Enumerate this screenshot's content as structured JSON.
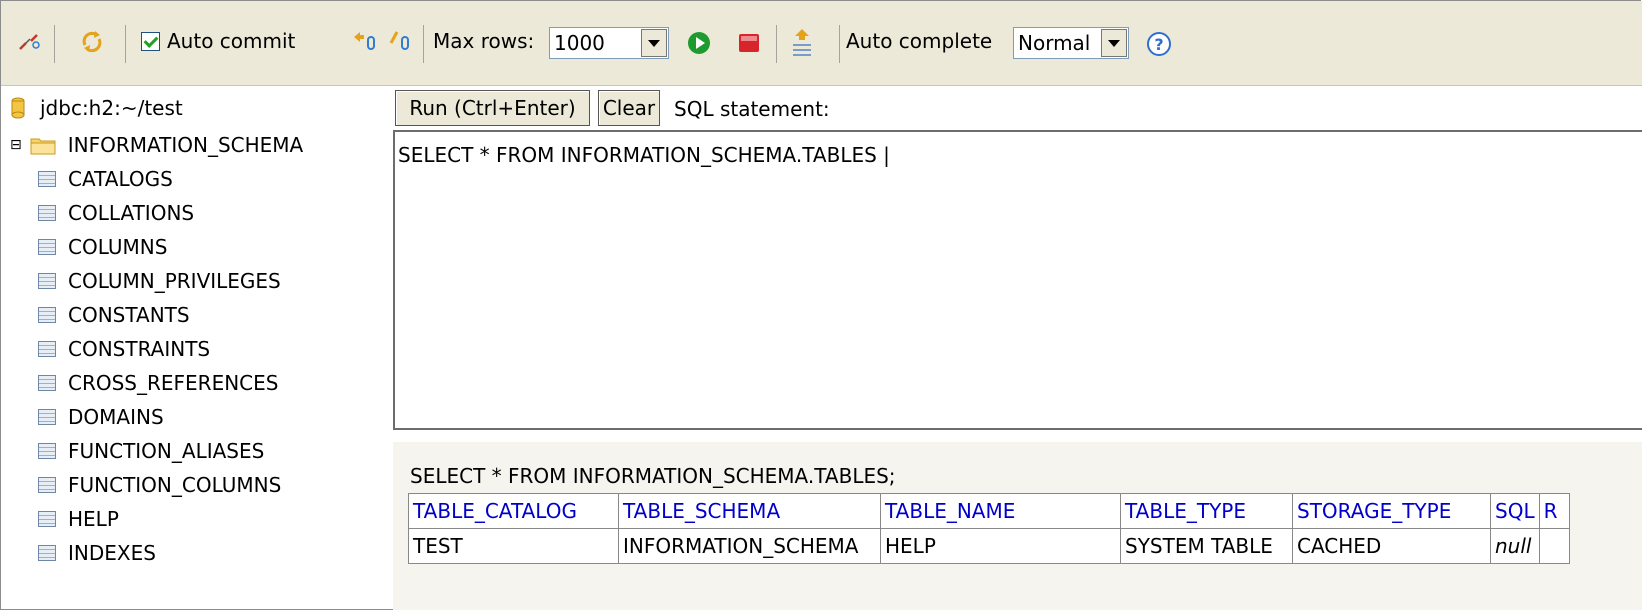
{
  "toolbar": {
    "auto_commit_label": "Auto commit",
    "auto_commit_checked": true,
    "max_rows_label": "Max rows:",
    "max_rows_value": "1000",
    "auto_complete_label": "Auto complete",
    "auto_complete_value": "Normal",
    "icons": [
      "disconnect-icon",
      "refresh-icon",
      "autocommit-on-icon",
      "autocommit-off-icon",
      "run-icon",
      "stop-icon",
      "history-icon",
      "help-icon"
    ]
  },
  "tree": {
    "connection": "jdbc:h2:~/test",
    "schema": "INFORMATION_SCHEMA",
    "expand_glyph": "⊟",
    "tables": [
      "CATALOGS",
      "COLLATIONS",
      "COLUMNS",
      "COLUMN_PRIVILEGES",
      "CONSTANTS",
      "CONSTRAINTS",
      "CROSS_REFERENCES",
      "DOMAINS",
      "FUNCTION_ALIASES",
      "FUNCTION_COLUMNS",
      "HELP",
      "INDEXES"
    ]
  },
  "query": {
    "run_label": "Run (Ctrl+Enter)",
    "clear_label": "Clear",
    "statement_label": "SQL statement:",
    "editor_text": "SELECT * FROM INFORMATION_SCHEMA.TABLES |"
  },
  "results": {
    "title": "SELECT * FROM INFORMATION_SCHEMA.TABLES;",
    "columns": [
      "TABLE_CATALOG",
      "TABLE_SCHEMA",
      "TABLE_NAME",
      "TABLE_TYPE",
      "STORAGE_TYPE",
      "SQL",
      "R"
    ],
    "rows": [
      [
        "TEST",
        "INFORMATION_SCHEMA",
        "HELP",
        "SYSTEM TABLE",
        "CACHED",
        "null",
        ""
      ]
    ]
  },
  "colors": {
    "toolbar_bg": "#ece9d8",
    "header_link": "#0000cc",
    "run_green": "#1e9b2e",
    "stop_red": "#d7262b"
  }
}
